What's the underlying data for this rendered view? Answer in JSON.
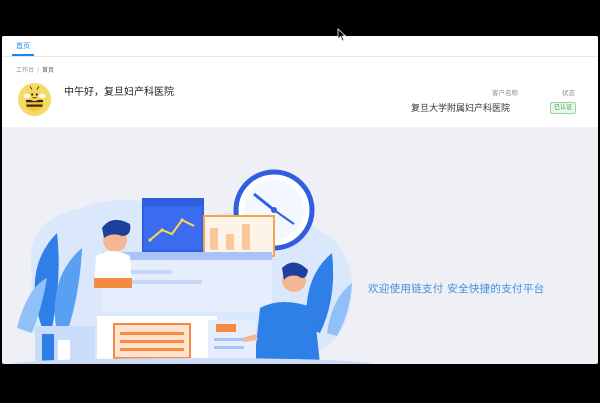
{
  "tabs": [
    {
      "label": "首页"
    }
  ],
  "breadcrumb": {
    "root": "工作台",
    "separator": "/",
    "current": "首页"
  },
  "greeting": "中午好，复旦妇产科医院",
  "customer": {
    "label": "客户名称",
    "value": "复旦大学附属妇产科医院"
  },
  "status": {
    "label": "状态",
    "value": "已认证"
  },
  "banner": {
    "welcome_text": "欢迎使用链支付 安全快捷的支付平台"
  },
  "colors": {
    "accent": "#1e88e5",
    "background": "#eef0f5",
    "success": "#3c9a3c",
    "welcome": "#3f8fe0"
  },
  "icons": {
    "avatar": "bee-avatar-icon",
    "cursor": "mouse-cursor-icon"
  }
}
